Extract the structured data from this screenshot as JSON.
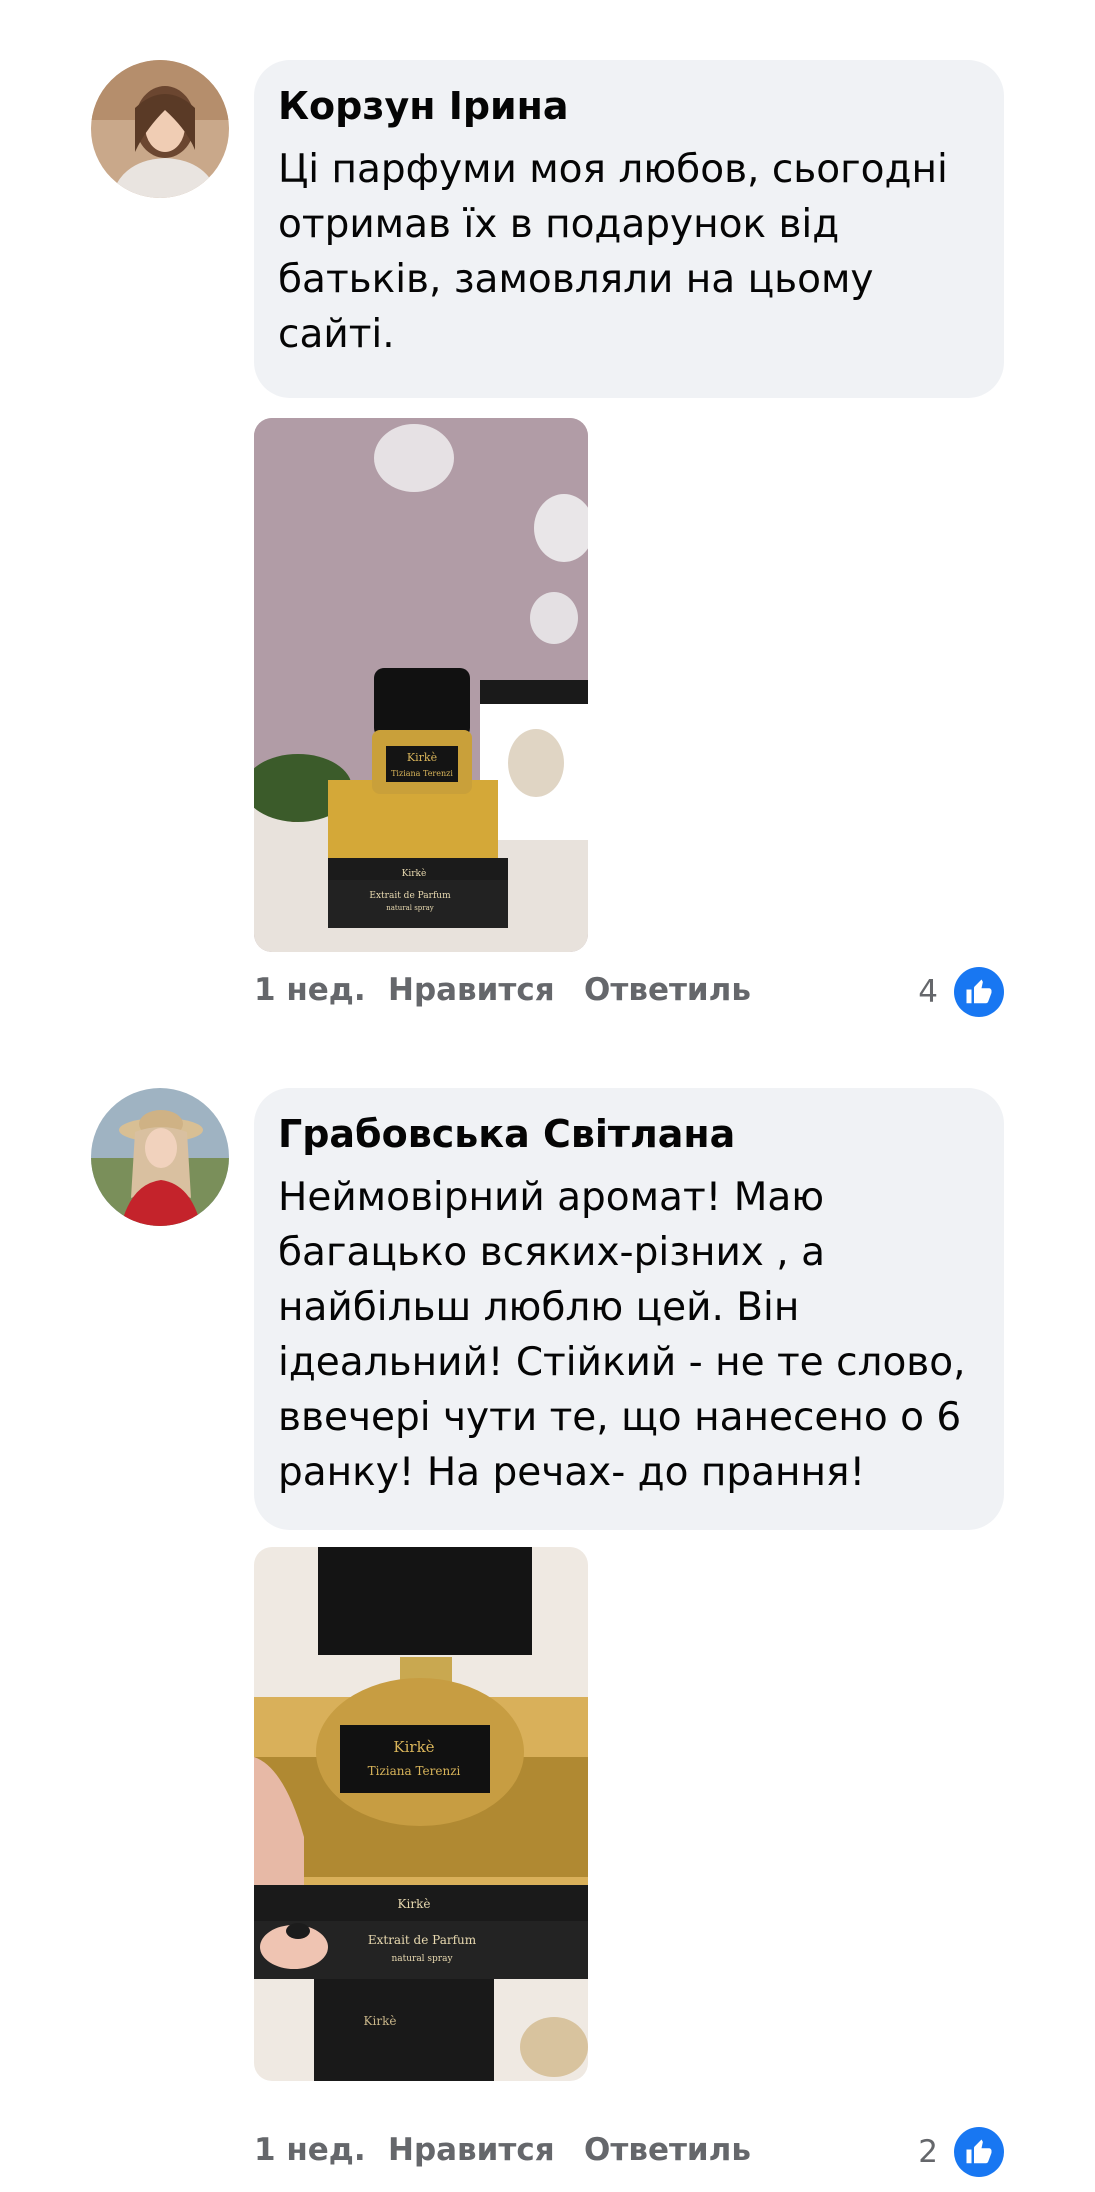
{
  "comments": [
    {
      "author": "Корзун Ірина",
      "text": "Ці парфуми моя любов, сьогодні отримав їх в подарунок від батьків, замовляли на цьому сайті.",
      "time": "1 нед.",
      "like_label": "Нравится",
      "reply_label": "Ответиль",
      "like_count": "4",
      "photo": {
        "cap_label": "Kirkè",
        "brand_label": "Tiziana Terenzi",
        "box_label": "Kirkè",
        "box_sub": "Extrait de Parfum",
        "box_sub2": "natural spray"
      }
    },
    {
      "author": "Грабовська Світлана",
      "text": "Неймовірний аромат! Маю багацько всяких-різних , а найбільш люблю цей. Він ідеальний! Стійкий - не те слово, ввечері чути те, що нанесено о 6 ранку! На речах- до прання!",
      "time": "1 нед.",
      "like_label": "Нравится",
      "reply_label": "Ответиль",
      "like_count": "2",
      "photo": {
        "cap_label": "Kirkè",
        "brand_label": "Tiziana Terenzi",
        "box_label": "Kirkè",
        "box_sub": "Extrait de Parfum",
        "box_sub2": "natural spray",
        "box_label2": "Kirkè"
      }
    }
  ],
  "icons": {
    "like": "thumbs-up-icon"
  },
  "colors": {
    "bubble": "#f0f2f5",
    "action_text": "#65676b",
    "like_badge": "#1877f2"
  }
}
